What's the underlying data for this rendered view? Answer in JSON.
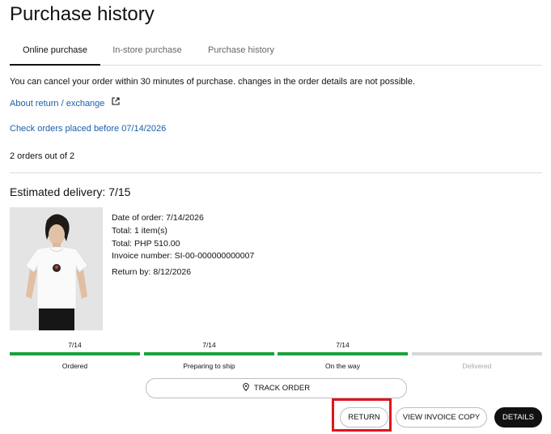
{
  "page": {
    "title": "Purchase history"
  },
  "tabs": [
    {
      "label": "Online purchase",
      "active": true
    },
    {
      "label": "In-store purchase",
      "active": false
    },
    {
      "label": "Purchase history",
      "active": false
    }
  ],
  "notice": "You can cancel your order within 30 minutes of purchase. changes in the order details are not possible.",
  "links": {
    "return_exchange": "About return / exchange",
    "older_orders": "Check orders placed before 07/14/2026"
  },
  "orders_count": "2 orders out of 2",
  "order": {
    "estimated_delivery": "Estimated delivery: 7/15",
    "date_of_order": "Date of order: 7/14/2026",
    "total_items": "Total: 1 item(s)",
    "total_price": "Total: PHP 510.00",
    "invoice_number": "Invoice number: SI-00-000000000007",
    "return_by": "Return by: 8/12/2026"
  },
  "progress": {
    "steps": [
      {
        "date": "7/14",
        "label": "Ordered",
        "done": true
      },
      {
        "date": "7/14",
        "label": "Preparing to ship",
        "done": true
      },
      {
        "date": "7/14",
        "label": "On the way",
        "done": true
      },
      {
        "date": "",
        "label": "Delivered",
        "done": false
      }
    ],
    "colors": {
      "done": "#1aa33a",
      "pending": "#d8d8d8"
    }
  },
  "actions": {
    "track_order": "TRACK ORDER",
    "return": "RETURN",
    "view_invoice": "VIEW INVOICE COPY",
    "details": "DETAILS"
  },
  "icons": {
    "external_link": "external-link-icon",
    "location": "location-pin-icon"
  },
  "highlight_color": "#e0141e"
}
